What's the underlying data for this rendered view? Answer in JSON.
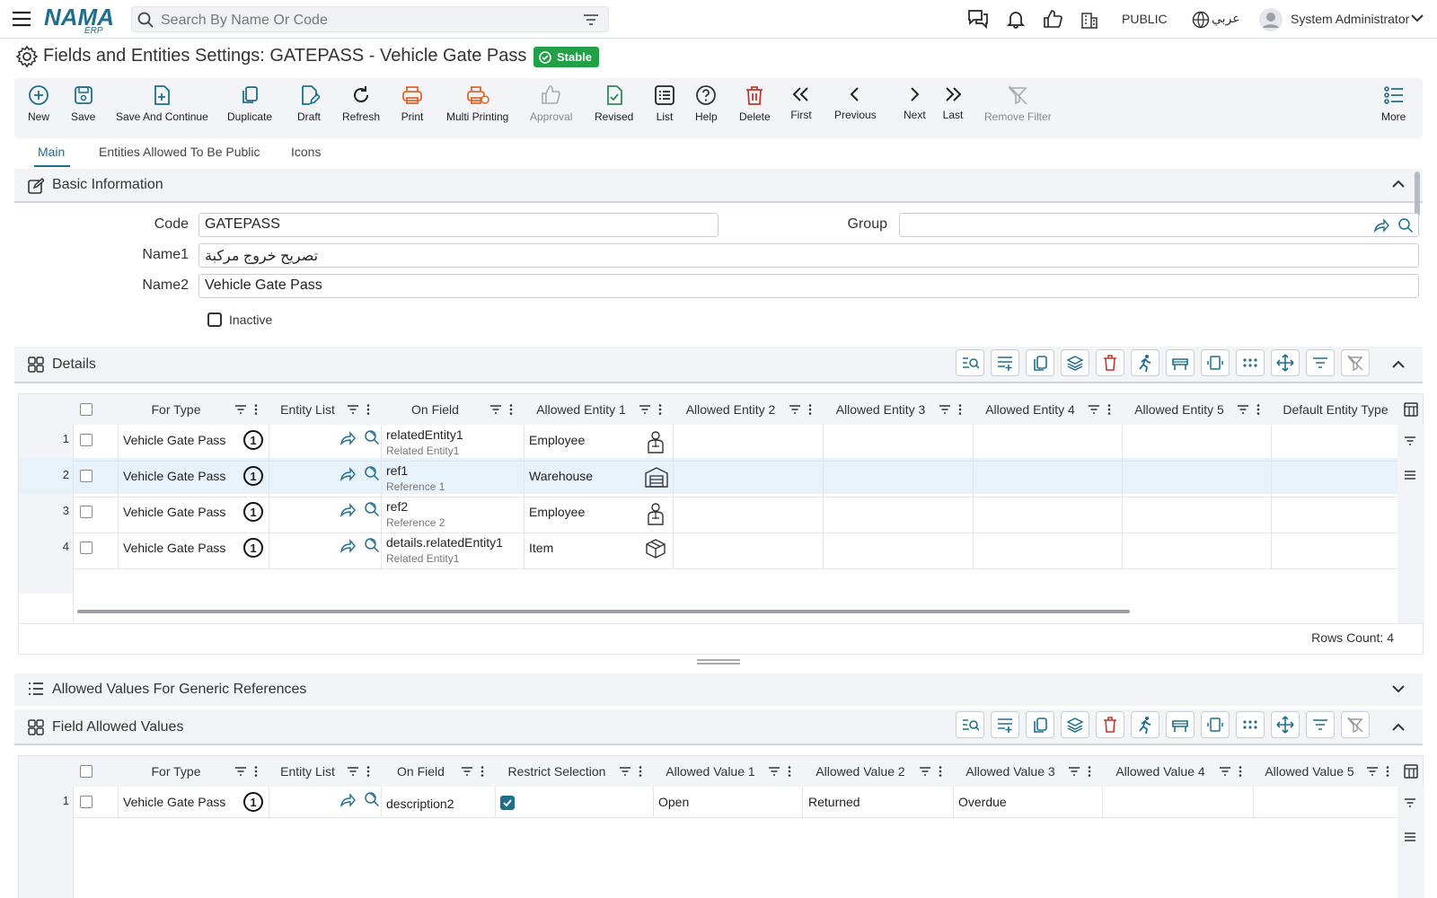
{
  "search": {
    "placeholder": "Search By Name Or Code"
  },
  "header": {
    "public_label": "PUBLIC",
    "language_label": "عربي",
    "user_name": "System Administrator"
  },
  "logo": {
    "text": "NAMA",
    "sub": "ERP"
  },
  "page": {
    "title": "Fields and Entities Settings: GATEPASS - Vehicle Gate Pass",
    "status_badge": "Stable"
  },
  "toolbar": {
    "new": "New",
    "save": "Save",
    "save_continue": "Save And Continue",
    "duplicate": "Duplicate",
    "draft": "Draft",
    "refresh": "Refresh",
    "print": "Print",
    "multi_printing": "Multi Printing",
    "approval": "Approval",
    "revised": "Revised",
    "list": "List",
    "help": "Help",
    "delete": "Delete",
    "first": "First",
    "previous": "Previous",
    "next": "Next",
    "last": "Last",
    "remove_filter": "Remove Filter",
    "more": "More"
  },
  "tabs": [
    "Main",
    "Entities Allowed To Be Public",
    "Icons"
  ],
  "basic_info": {
    "title": "Basic Information",
    "code_label": "Code",
    "code_value": "GATEPASS",
    "group_label": "Group",
    "group_value": "",
    "name1_label": "Name1",
    "name1_value": "تصريح خروج مركبة",
    "name2_label": "Name2",
    "name2_value": "Vehicle Gate Pass",
    "inactive_label": "Inactive"
  },
  "details": {
    "title": "Details",
    "columns": [
      "For Type",
      "Entity List",
      "On Field",
      "Allowed Entity 1",
      "Allowed Entity 2",
      "Allowed Entity 3",
      "Allowed Entity 4",
      "Allowed Entity 5",
      "Default Entity Type"
    ],
    "rows": [
      {
        "num": "1",
        "for_type": "Vehicle Gate Pass",
        "on_field": "relatedEntity1",
        "on_field_sub": "Related Entity1",
        "entity1": "Employee",
        "entity1_icon": "employee-icon"
      },
      {
        "num": "2",
        "for_type": "Vehicle Gate Pass",
        "on_field": "ref1",
        "on_field_sub": "Reference 1",
        "entity1": "Warehouse",
        "entity1_icon": "warehouse-icon"
      },
      {
        "num": "3",
        "for_type": "Vehicle Gate Pass",
        "on_field": "ref2",
        "on_field_sub": "Reference 2",
        "entity1": "Employee",
        "entity1_icon": "employee-icon"
      },
      {
        "num": "4",
        "for_type": "Vehicle Gate Pass",
        "on_field": "details.relatedEntity1",
        "on_field_sub": "Related Entity1",
        "entity1": "Item",
        "entity1_icon": "item-box-icon"
      }
    ],
    "rows_count": "Rows Count: 4"
  },
  "allowed_values_section": {
    "title": "Allowed Values For Generic References"
  },
  "field_allowed_values": {
    "title": "Field Allowed Values",
    "columns": [
      "For Type",
      "Entity List",
      "On Field",
      "Restrict Selection",
      "Allowed Value 1",
      "Allowed Value 2",
      "Allowed Value 3",
      "Allowed Value 4",
      "Allowed Value 5"
    ],
    "rows": [
      {
        "num": "1",
        "for_type": "Vehicle Gate Pass",
        "on_field": "description2",
        "restrict": true,
        "v1": "Open",
        "v2": "Returned",
        "v3": "Overdue"
      }
    ]
  },
  "colors": {
    "accent": "#1f6e8c",
    "stable": "#21a047",
    "print": "#e0672a",
    "delete": "#c0392b",
    "revised": "#2e8b57"
  }
}
